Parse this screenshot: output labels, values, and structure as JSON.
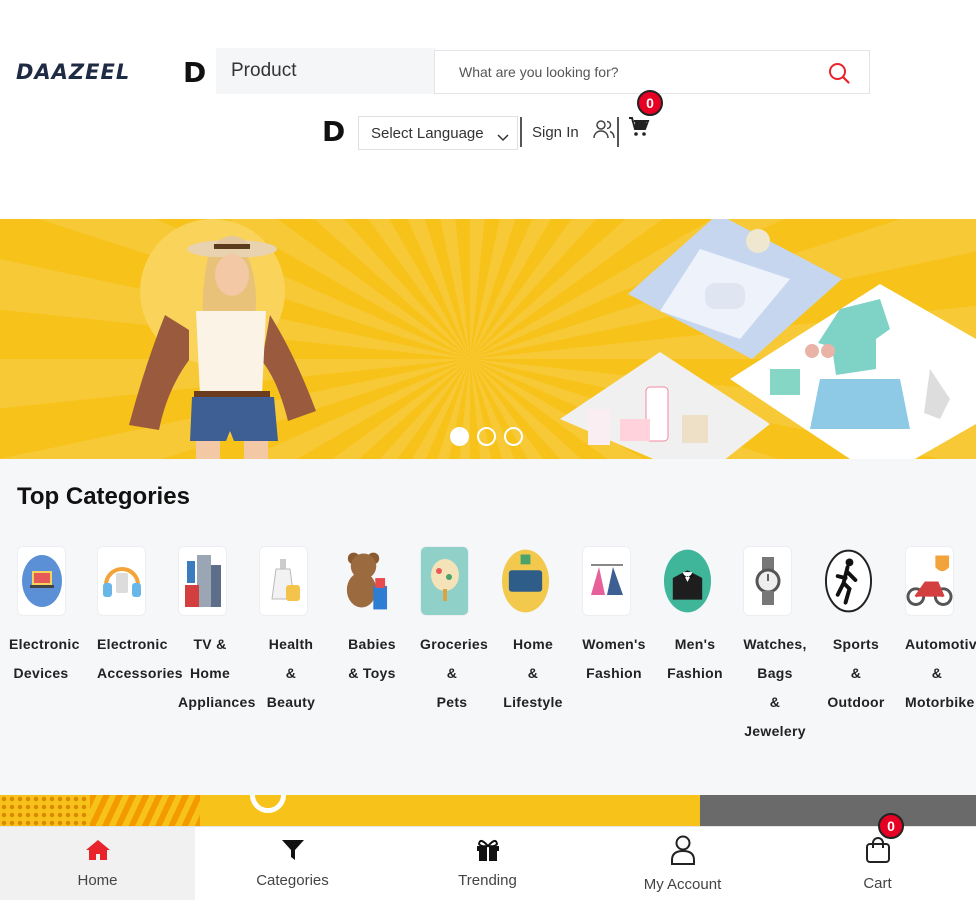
{
  "header": {
    "logo": "DAAZEEL",
    "d_mark": "D",
    "search_type": "Product",
    "search_placeholder": "What are you looking for?",
    "language_select": "Select Language",
    "sign_in": "Sign In",
    "cart_count": "0"
  },
  "banner": {
    "slide_count": 3,
    "active_slide": 1
  },
  "top_categories": {
    "title": "Top Categories",
    "items": [
      {
        "label": "Electronic\nDevices",
        "icon": "laptop-icon"
      },
      {
        "label": "Electronic\nAccessories",
        "icon": "headphones-icon"
      },
      {
        "label": "TV &\nHome\nAppliances",
        "icon": "appliance-icon"
      },
      {
        "label": "Health\n&\nBeauty",
        "icon": "beauty-bottle-icon"
      },
      {
        "label": "Babies\n& Toys",
        "icon": "teddy-bear-icon"
      },
      {
        "label": "Groceries\n&\nPets",
        "icon": "grocery-icon"
      },
      {
        "label": "Home\n&\nLifestyle",
        "icon": "sofa-icon"
      },
      {
        "label": "Women's\nFashion",
        "icon": "dress-icon"
      },
      {
        "label": "Men's\nFashion",
        "icon": "tuxedo-icon"
      },
      {
        "label": "Watches,\nBags\n&\nJewelery",
        "icon": "watch-icon"
      },
      {
        "label": "Sports\n&\nOutdoor",
        "icon": "runner-icon"
      },
      {
        "label": "Automotive\n&\nMotorbike",
        "icon": "motorbike-icon"
      }
    ]
  },
  "bottom_nav": {
    "items": [
      {
        "label": "Home",
        "icon": "home-icon"
      },
      {
        "label": "Categories",
        "icon": "filter-icon"
      },
      {
        "label": "Trending",
        "icon": "gift-icon"
      },
      {
        "label": "My Account",
        "icon": "user-icon"
      },
      {
        "label": "Cart",
        "icon": "shopping-bag-icon"
      }
    ],
    "cart_count": "0"
  },
  "colors": {
    "accent_red": "#e8232b",
    "banner_yellow": "#f7c21a"
  }
}
